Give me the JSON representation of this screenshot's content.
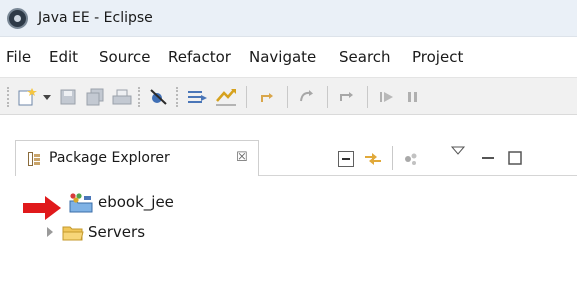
{
  "window": {
    "title": "Java EE - Eclipse"
  },
  "menubar": {
    "items": [
      "File",
      "Edit",
      "Source",
      "Refactor",
      "Navigate",
      "Search",
      "Project"
    ]
  },
  "toolbar": {
    "icons": [
      "new-wizard-icon",
      "dropdown-arrow-icon",
      "save-icon",
      "save-all-icon",
      "print-icon",
      "skip-breakpoints-icon",
      "build-icon",
      "open-perspective-icon",
      "step-icon",
      "redo-icon",
      "run-icon",
      "pause-icon"
    ]
  },
  "view": {
    "tab_label": "Package Explorer",
    "close_glyph": "☒",
    "tab_icon": "package-explorer-icon",
    "toolbar_icons": [
      "collapse-all-icon",
      "link-with-editor-icon",
      "focus-icon",
      "view-menu-icon",
      "minimize-icon",
      "maximize-icon"
    ]
  },
  "tree": {
    "items": [
      {
        "label": "ebook_jee",
        "icon": "java-project-icon",
        "highlighted": true
      },
      {
        "label": "Servers",
        "icon": "folder-icon",
        "expandable": true
      }
    ]
  },
  "annotation": {
    "arrow_color": "#e0191b"
  }
}
